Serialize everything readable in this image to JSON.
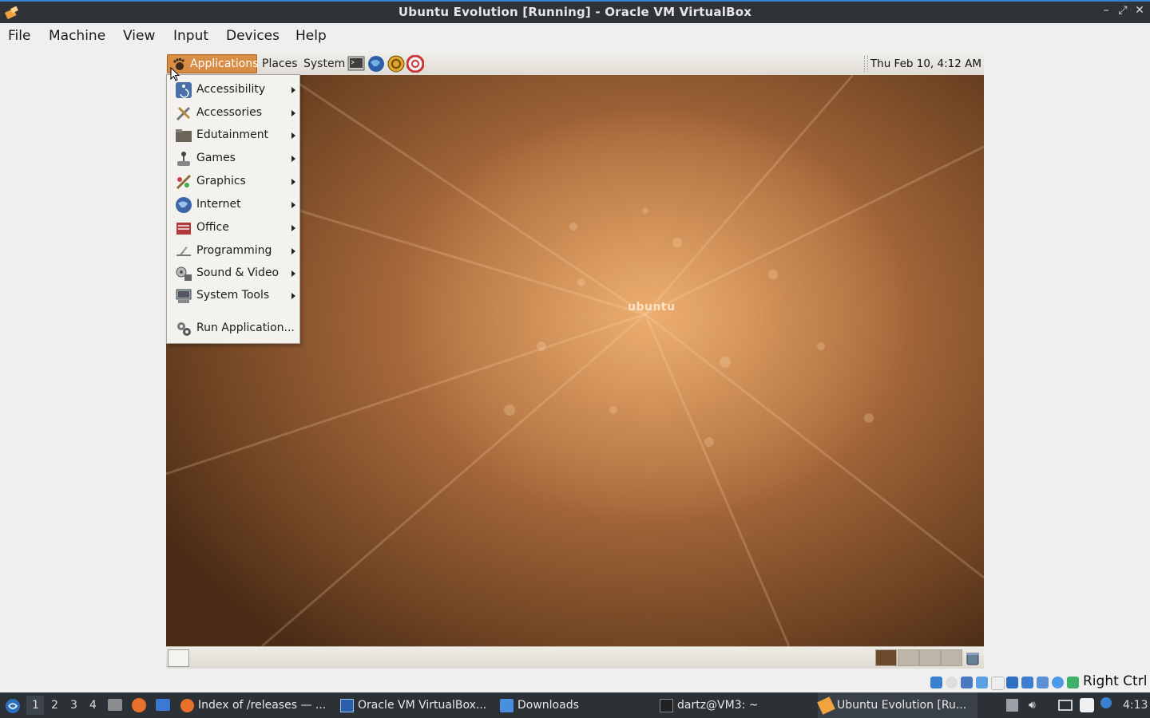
{
  "window": {
    "title": "Ubuntu Evolution [Running] - Oracle VM VirtualBox",
    "controls": [
      "–",
      "⤢",
      "✕"
    ]
  },
  "menubar": {
    "items": [
      "File",
      "Machine",
      "View",
      "Input",
      "Devices",
      "Help"
    ]
  },
  "guest": {
    "top_panel": {
      "applications_label": "Applications",
      "places_label": "Places",
      "system_label": "System",
      "launchers": [
        "terminal-icon",
        "web-browser-icon",
        "mail-icon",
        "help-icon"
      ],
      "clock": "Thu Feb 10,  4:12 AM"
    },
    "wallpaper_logo": "ubuntu",
    "applications_menu": {
      "items": [
        {
          "label": "Accessibility",
          "icon": "accessibility-icon",
          "submenu": true
        },
        {
          "label": "Accessories",
          "icon": "accessories-icon",
          "submenu": true
        },
        {
          "label": "Edutainment",
          "icon": "folder-icon",
          "submenu": true
        },
        {
          "label": "Games",
          "icon": "joystick-icon",
          "submenu": true
        },
        {
          "label": "Graphics",
          "icon": "graphics-icon",
          "submenu": true
        },
        {
          "label": "Internet",
          "icon": "globe-icon",
          "submenu": true
        },
        {
          "label": "Office",
          "icon": "office-icon",
          "submenu": true
        },
        {
          "label": "Programming",
          "icon": "programming-icon",
          "submenu": true
        },
        {
          "label": "Sound & Video",
          "icon": "sound-video-icon",
          "submenu": true
        },
        {
          "label": "System Tools",
          "icon": "system-tools-icon",
          "submenu": true
        },
        {
          "label": "Run Application...",
          "icon": "gears-icon",
          "submenu": false
        }
      ]
    },
    "bottom_panel": {
      "workspace_colors": [
        "#6b4a2e",
        "#bdb6a8",
        "#bdb6a8",
        "#bdb6a8"
      ]
    }
  },
  "vbox_status": {
    "host_key": "Right Ctrl"
  },
  "taskbar": {
    "workspaces": [
      "1",
      "2",
      "3",
      "4"
    ],
    "tasks": [
      {
        "label": "Index of /releases — ...",
        "icon": "firefox-icon"
      },
      {
        "label": "Oracle VM VirtualBox...",
        "icon": "virtualbox-icon"
      },
      {
        "label": "Downloads",
        "icon": "folder-icon"
      },
      {
        "label": "dartz@VM3: ~",
        "icon": "terminal-icon"
      },
      {
        "label": "Ubuntu Evolution [Ru...",
        "icon": "virtualbox-vm-icon"
      }
    ],
    "clock": "4:13"
  },
  "colors": {
    "accent": "#3d7fd1",
    "apps_highlight": "#d98c43",
    "taskbar_bg": "#2c3136"
  }
}
